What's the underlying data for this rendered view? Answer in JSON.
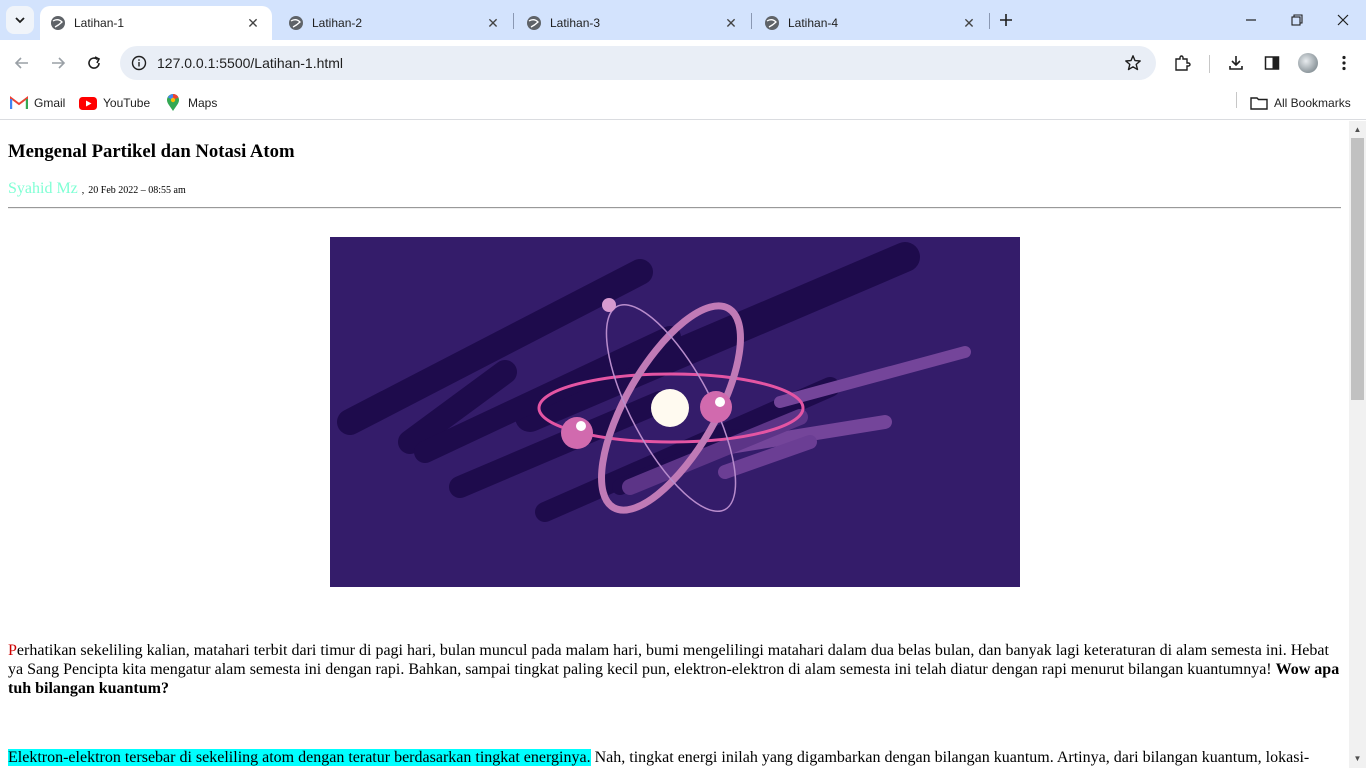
{
  "browser": {
    "tabs": [
      {
        "title": "Latihan-1",
        "active": true
      },
      {
        "title": "Latihan-2",
        "active": false
      },
      {
        "title": "Latihan-3",
        "active": false
      },
      {
        "title": "Latihan-4",
        "active": false
      }
    ],
    "url": "127.0.0.1:5500/Latihan-1.html",
    "bookmarks": [
      {
        "label": "Gmail",
        "icon": "gmail-icon"
      },
      {
        "label": "YouTube",
        "icon": "youtube-icon"
      },
      {
        "label": "Maps",
        "icon": "maps-icon"
      }
    ],
    "all_bookmarks_label": "All Bookmarks",
    "accent": "#d3e3fd"
  },
  "article": {
    "title": "Mengenal Partikel dan Notasi Atom",
    "author": "Syahid Mz",
    "date_sep": ",",
    "date": "20 Feb 2022 – 08:55 am",
    "author_color": "#7fffd4",
    "image_icon": "atom-illustration",
    "para1_dropcap": "P",
    "para1_text": "erhatikan sekeliling kalian, matahari terbit dari timur di pagi hari, bulan muncul pada malam hari, bumi mengelilingi matahari dalam dua belas bulan, dan banyak lagi keteraturan di alam semesta ini. Hebat ya Sang Pencipta kita mengatur alam semesta ini dengan rapi. Bahkan, sampai tingkat paling kecil pun, elektron-elektron di alam semesta ini telah diatur dengan rapi menurut bilangan kuantumnya!",
    "para1_bold": "Wow apa tuh bilangan kuantum?",
    "para2_highlight": "Elektron-elektron tersebar di sekeliling atom dengan teratur berdasarkan tingkat energinya.",
    "para2_text": "Nah, tingkat energi inilah yang digambarkan dengan bilangan kuantum. Artinya, dari bilangan kuantum, lokasi-",
    "highlight_color": "#00ffff",
    "dropcap_color": "#cc0000"
  }
}
